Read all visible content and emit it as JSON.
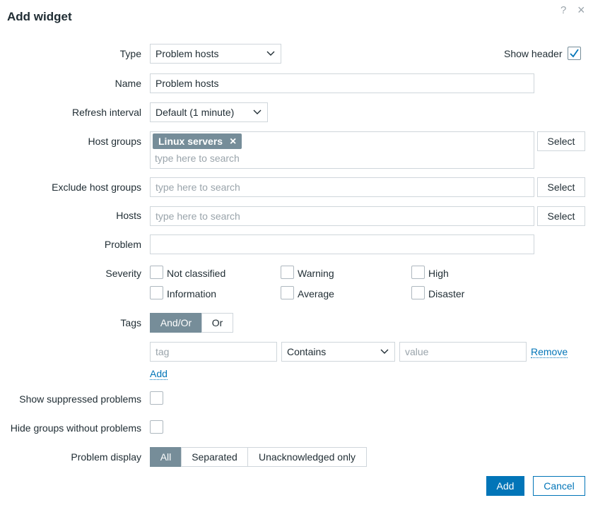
{
  "dialog": {
    "title": "Add widget",
    "help_icon": "?",
    "close_icon": "×"
  },
  "form": {
    "type": {
      "label": "Type",
      "value": "Problem hosts"
    },
    "show_header": {
      "label": "Show header",
      "checked": true
    },
    "name": {
      "label": "Name",
      "value": "Problem hosts"
    },
    "refresh": {
      "label": "Refresh interval",
      "value": "Default (1 minute)"
    },
    "host_groups": {
      "label": "Host groups",
      "chip": "Linux servers",
      "chip_remove": "×",
      "placeholder": "type here to search",
      "select_label": "Select"
    },
    "exclude_host_groups": {
      "label": "Exclude host groups",
      "placeholder": "type here to search",
      "select_label": "Select"
    },
    "hosts": {
      "label": "Hosts",
      "placeholder": "type here to search",
      "select_label": "Select"
    },
    "problem": {
      "label": "Problem",
      "value": ""
    },
    "severity": {
      "label": "Severity",
      "options": [
        "Not classified",
        "Warning",
        "High",
        "Information",
        "Average",
        "Disaster"
      ]
    },
    "tags": {
      "label": "Tags",
      "modes": [
        "And/Or",
        "Or"
      ],
      "active_mode": "And/Or",
      "tag_placeholder": "tag",
      "operator": "Contains",
      "value_placeholder": "value",
      "remove_label": "Remove",
      "add_label": "Add"
    },
    "show_suppressed": {
      "label": "Show suppressed problems",
      "checked": false
    },
    "hide_groups": {
      "label": "Hide groups without problems",
      "checked": false
    },
    "problem_display": {
      "label": "Problem display",
      "options": [
        "All",
        "Separated",
        "Unacknowledged only"
      ],
      "active": "All"
    }
  },
  "footer": {
    "add_label": "Add",
    "cancel_label": "Cancel"
  },
  "colors": {
    "accent": "#0275b8",
    "segment_active": "#768d99",
    "border": "#cfd6db",
    "text": "#1f2c33"
  }
}
